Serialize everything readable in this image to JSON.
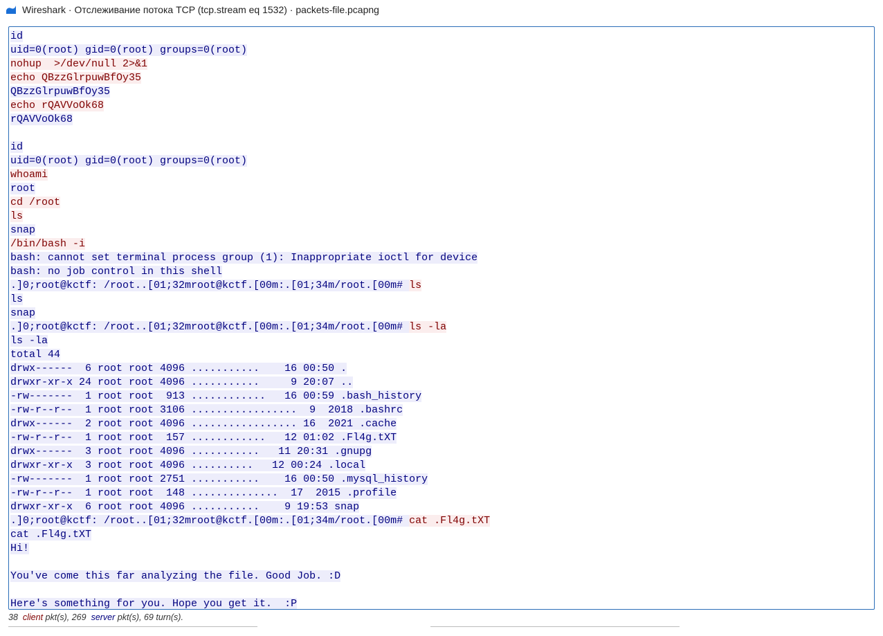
{
  "window": {
    "app": "Wireshark",
    "title": "Wireshark · Отслеживание потока TCP (tcp.stream eq 1532) · packets-file.pcapng"
  },
  "status": {
    "client_pkts": "38",
    "client_label": "client",
    "sep1": " pkt(s), ",
    "server_pkts": "269",
    "server_label": "server",
    "sep2": " pkt(s), ",
    "turns": "69 turn(s)."
  },
  "colors": {
    "client_fg": "#7f0000",
    "client_bg": "#fbeded",
    "server_fg": "#00007f",
    "server_bg": "#ededfb"
  },
  "lines": [
    {
      "d": "s",
      "t": "id"
    },
    {
      "d": "s",
      "t": "uid=0(root) gid=0(root) groups=0(root)"
    },
    {
      "d": "c",
      "t": "nohup  >/dev/null 2>&1"
    },
    {
      "d": "c",
      "t": "echo QBzzGlrpuwBfOy35"
    },
    {
      "d": "s",
      "t": "QBzzGlrpuwBfOy35"
    },
    {
      "d": "c",
      "t": "echo rQAVVoOk68"
    },
    {
      "d": "s",
      "t": "rQAVVoOk68"
    },
    {
      "d": "blank",
      "t": ""
    },
    {
      "d": "s",
      "t": "id"
    },
    {
      "d": "s",
      "t": "uid=0(root) gid=0(root) groups=0(root)"
    },
    {
      "d": "c",
      "t": "whoami"
    },
    {
      "d": "s",
      "t": "root"
    },
    {
      "d": "c",
      "t": "cd /root"
    },
    {
      "d": "c",
      "t": "ls"
    },
    {
      "d": "s",
      "t": "snap"
    },
    {
      "d": "c",
      "t": "/bin/bash -i"
    },
    {
      "d": "s",
      "t": "bash: cannot set terminal process group (1): Inappropriate ioctl for device"
    },
    {
      "d": "s",
      "t": "bash: no job control in this shell"
    },
    {
      "d": "mix",
      "parts": [
        {
          "d": "s",
          "t": ".]0;root@kctf: /root..[01;32mroot@kctf.[00m:.[01;34m/root.[00m# "
        },
        {
          "d": "c",
          "t": "ls"
        }
      ]
    },
    {
      "d": "s",
      "t": "ls"
    },
    {
      "d": "s",
      "t": "snap"
    },
    {
      "d": "mix",
      "parts": [
        {
          "d": "s",
          "t": ".]0;root@kctf: /root..[01;32mroot@kctf.[00m:.[01;34m/root.[00m# "
        },
        {
          "d": "c",
          "t": "ls -la"
        }
      ]
    },
    {
      "d": "s",
      "t": "ls -la"
    },
    {
      "d": "s",
      "t": "total 44"
    },
    {
      "d": "s",
      "t": "drwx------  6 root root 4096 ...........    16 00:50 ."
    },
    {
      "d": "s",
      "t": "drwxr-xr-x 24 root root 4096 ...........     9 20:07 .."
    },
    {
      "d": "s",
      "t": "-rw-------  1 root root  913 ............   16 00:59 .bash_history"
    },
    {
      "d": "s",
      "t": "-rw-r--r--  1 root root 3106 .................  9  2018 .bashrc"
    },
    {
      "d": "s",
      "t": "drwx------  2 root root 4096 ................. 16  2021 .cache"
    },
    {
      "d": "s",
      "t": "-rw-r--r--  1 root root  157 ............   12 01:02 .Fl4g.tXT"
    },
    {
      "d": "s",
      "t": "drwx------  3 root root 4096 ...........   11 20:31 .gnupg"
    },
    {
      "d": "s",
      "t": "drwxr-xr-x  3 root root 4096 ..........   12 00:24 .local"
    },
    {
      "d": "s",
      "t": "-rw-------  1 root root 2751 ...........    16 00:50 .mysql_history"
    },
    {
      "d": "s",
      "t": "-rw-r--r--  1 root root  148 ..............  17  2015 .profile"
    },
    {
      "d": "s",
      "t": "drwxr-xr-x  6 root root 4096 ...........    9 19:53 snap"
    },
    {
      "d": "mix",
      "parts": [
        {
          "d": "s",
          "t": ".]0;root@kctf: /root..[01;32mroot@kctf.[00m:.[01;34m/root.[00m# "
        },
        {
          "d": "c",
          "t": "cat .Fl4g.tXT"
        }
      ]
    },
    {
      "d": "s",
      "t": "cat .Fl4g.tXT"
    },
    {
      "d": "s",
      "t": "Hi!"
    },
    {
      "d": "blank",
      "t": ""
    },
    {
      "d": "s",
      "t": "You've come this far analyzing the file. Good Job. :D"
    },
    {
      "d": "blank",
      "t": ""
    },
    {
      "d": "s",
      "t": "Here's something for you. Hope you get it.  :P"
    }
  ]
}
